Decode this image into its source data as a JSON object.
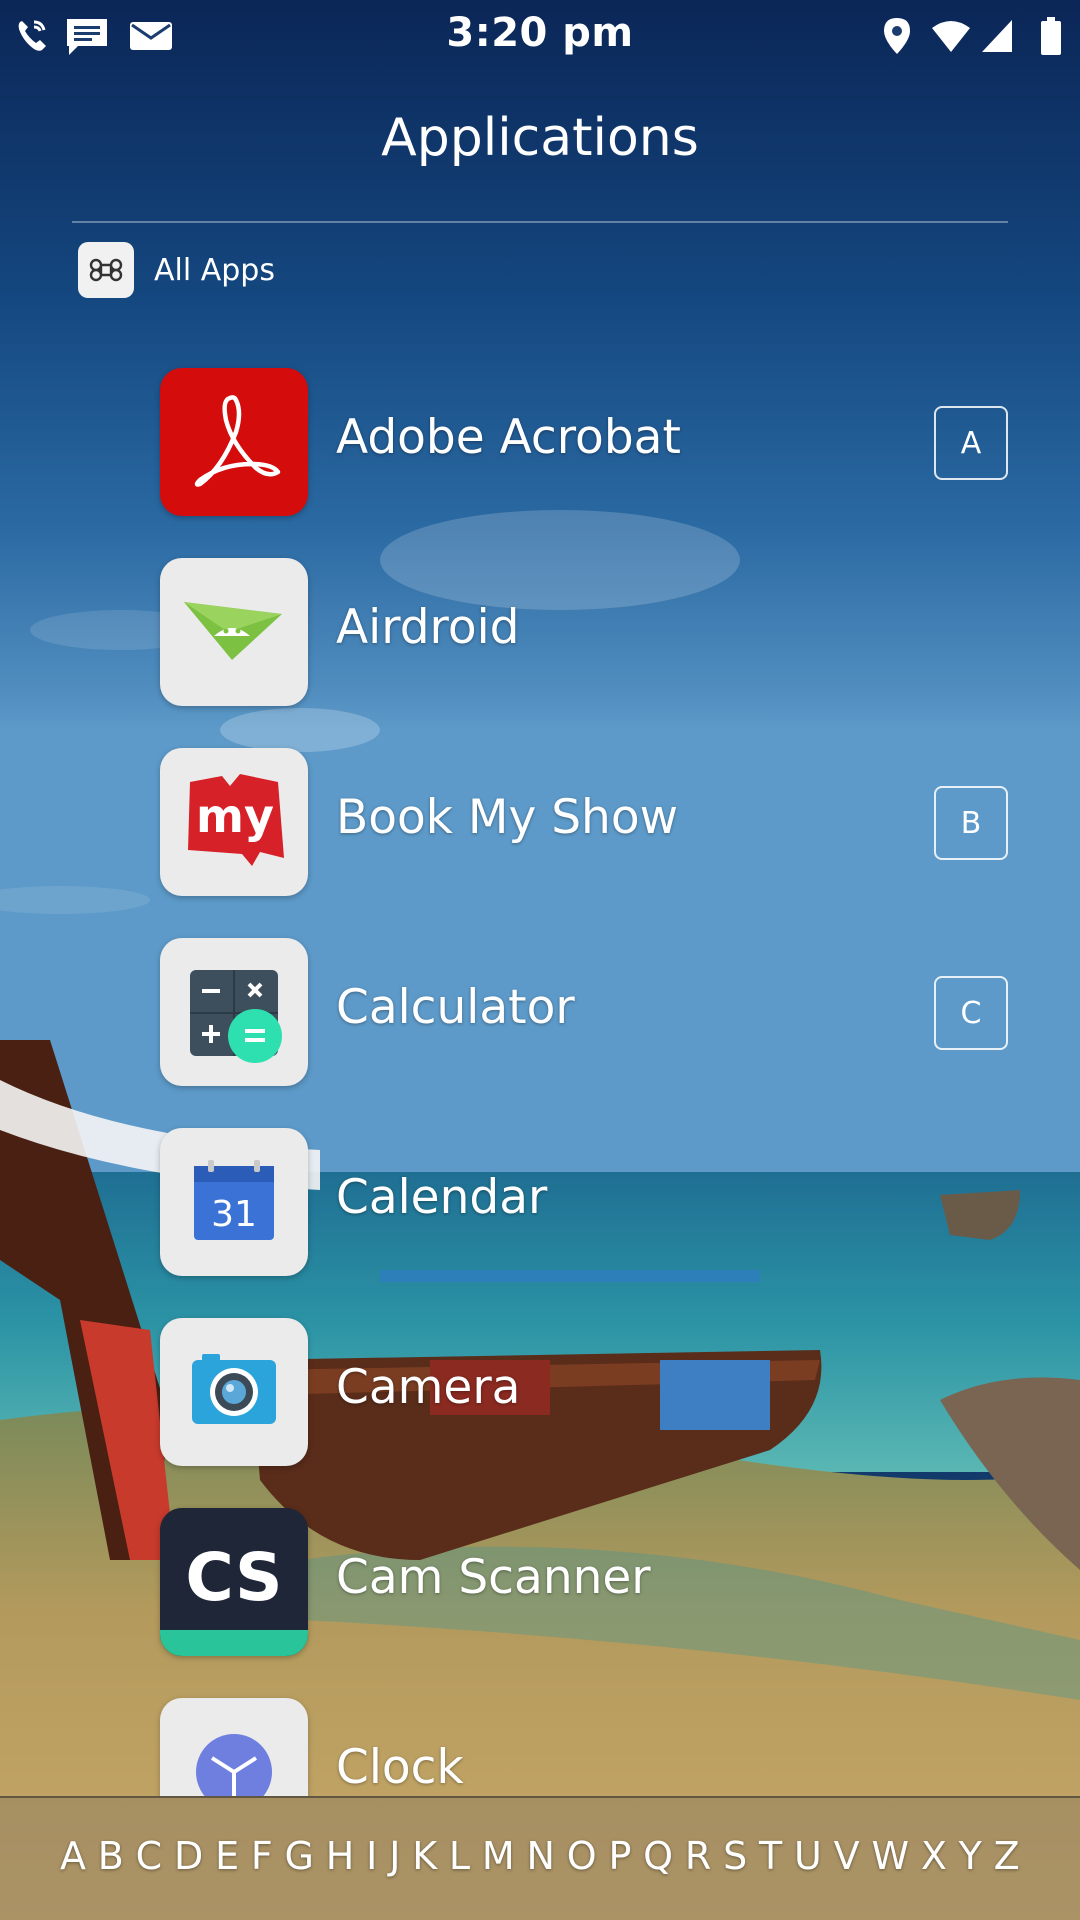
{
  "status_bar": {
    "time": "3:20 pm",
    "left_icons": [
      "phone-wifi-icon",
      "message-icon",
      "mail-icon"
    ],
    "right_icons": [
      "location-icon",
      "wifi-icon",
      "cell-signal-icon",
      "battery-icon"
    ]
  },
  "header": {
    "title": "Applications",
    "all_apps_label": "All Apps",
    "all_apps_icon": "command-icon"
  },
  "apps": [
    {
      "name": "Adobe Acrobat",
      "icon": "adobe-acrobat-icon",
      "letter": "A"
    },
    {
      "name": "Airdroid",
      "icon": "airdroid-icon",
      "letter": ""
    },
    {
      "name": "Book My Show",
      "icon": "book-my-show-icon",
      "letter": "B"
    },
    {
      "name": "Calculator",
      "icon": "calculator-icon",
      "letter": "C"
    },
    {
      "name": "Calendar",
      "icon": "calendar-icon",
      "letter": "",
      "calendar_day": "31"
    },
    {
      "name": "Camera",
      "icon": "camera-icon",
      "letter": ""
    },
    {
      "name": "Cam Scanner",
      "icon": "cam-scanner-icon",
      "letter": "",
      "icon_text": "CS"
    },
    {
      "name": "Clock",
      "icon": "clock-icon",
      "letter": ""
    }
  ],
  "book_my_show_icon_text": "my",
  "alphabet": [
    "A",
    "B",
    "C",
    "D",
    "E",
    "F",
    "G",
    "H",
    "I",
    "J",
    "K",
    "L",
    "M",
    "N",
    "O",
    "P",
    "Q",
    "R",
    "S",
    "T",
    "U",
    "V",
    "W",
    "X",
    "Y",
    "Z"
  ],
  "colors": {
    "acrobat_red": "#d40c0c",
    "airdroid_green": "#7cc142",
    "bms_red": "#d62129",
    "calc_teal": "#2ee0b0",
    "calendar_blue": "#3a72d6",
    "camera_blue": "#2ba4dc",
    "camscanner_dark": "#1e2638",
    "camscanner_teal": "#29c49a",
    "clock_purple": "#6f7fe0"
  }
}
